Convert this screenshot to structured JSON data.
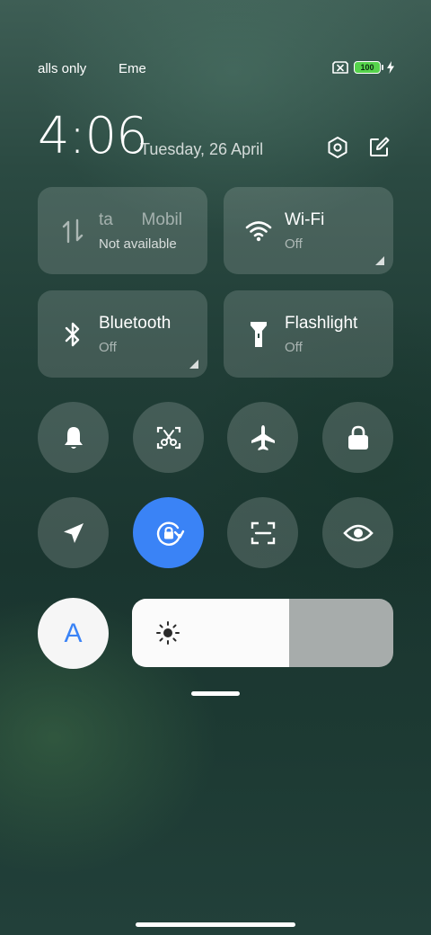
{
  "status_bar": {
    "carrier_1": "alls only",
    "carrier_2": "Eme",
    "battery_level": "100",
    "icons": [
      "sim-off-icon",
      "battery-icon",
      "charging-bolt-icon"
    ]
  },
  "header": {
    "time": "4:06",
    "date": "Tuesday, 26 April",
    "icons": [
      "settings-icon",
      "edit-icon"
    ]
  },
  "tiles": {
    "data": {
      "title_faded": "ta",
      "title": "Mobil",
      "subtitle": "Not available",
      "icon": "mobile-data-icon"
    },
    "wifi": {
      "title": "Wi-Fi",
      "subtitle": "Off",
      "icon": "wifi-icon"
    },
    "bluetooth": {
      "title": "Bluetooth",
      "subtitle": "Off",
      "icon": "bluetooth-icon"
    },
    "flashlight": {
      "title": "Flashlight",
      "subtitle": "Off",
      "icon": "flashlight-icon"
    }
  },
  "toggles": [
    {
      "icon": "bell-icon",
      "active": false
    },
    {
      "icon": "screenshot-icon",
      "active": false
    },
    {
      "icon": "airplane-icon",
      "active": false
    },
    {
      "icon": "lock-icon",
      "active": false
    },
    {
      "icon": "location-icon",
      "active": false
    },
    {
      "icon": "rotation-lock-icon",
      "active": true
    },
    {
      "icon": "scanner-icon",
      "active": false
    },
    {
      "icon": "reading-mode-icon",
      "active": false
    }
  ],
  "brightness": {
    "auto_label": "A",
    "level": 0.6,
    "icon": "brightness-icon"
  },
  "colors": {
    "accent": "#3a83f6",
    "battery": "#56d34c",
    "tile_bg": "rgba(255,255,255,0.15)"
  }
}
